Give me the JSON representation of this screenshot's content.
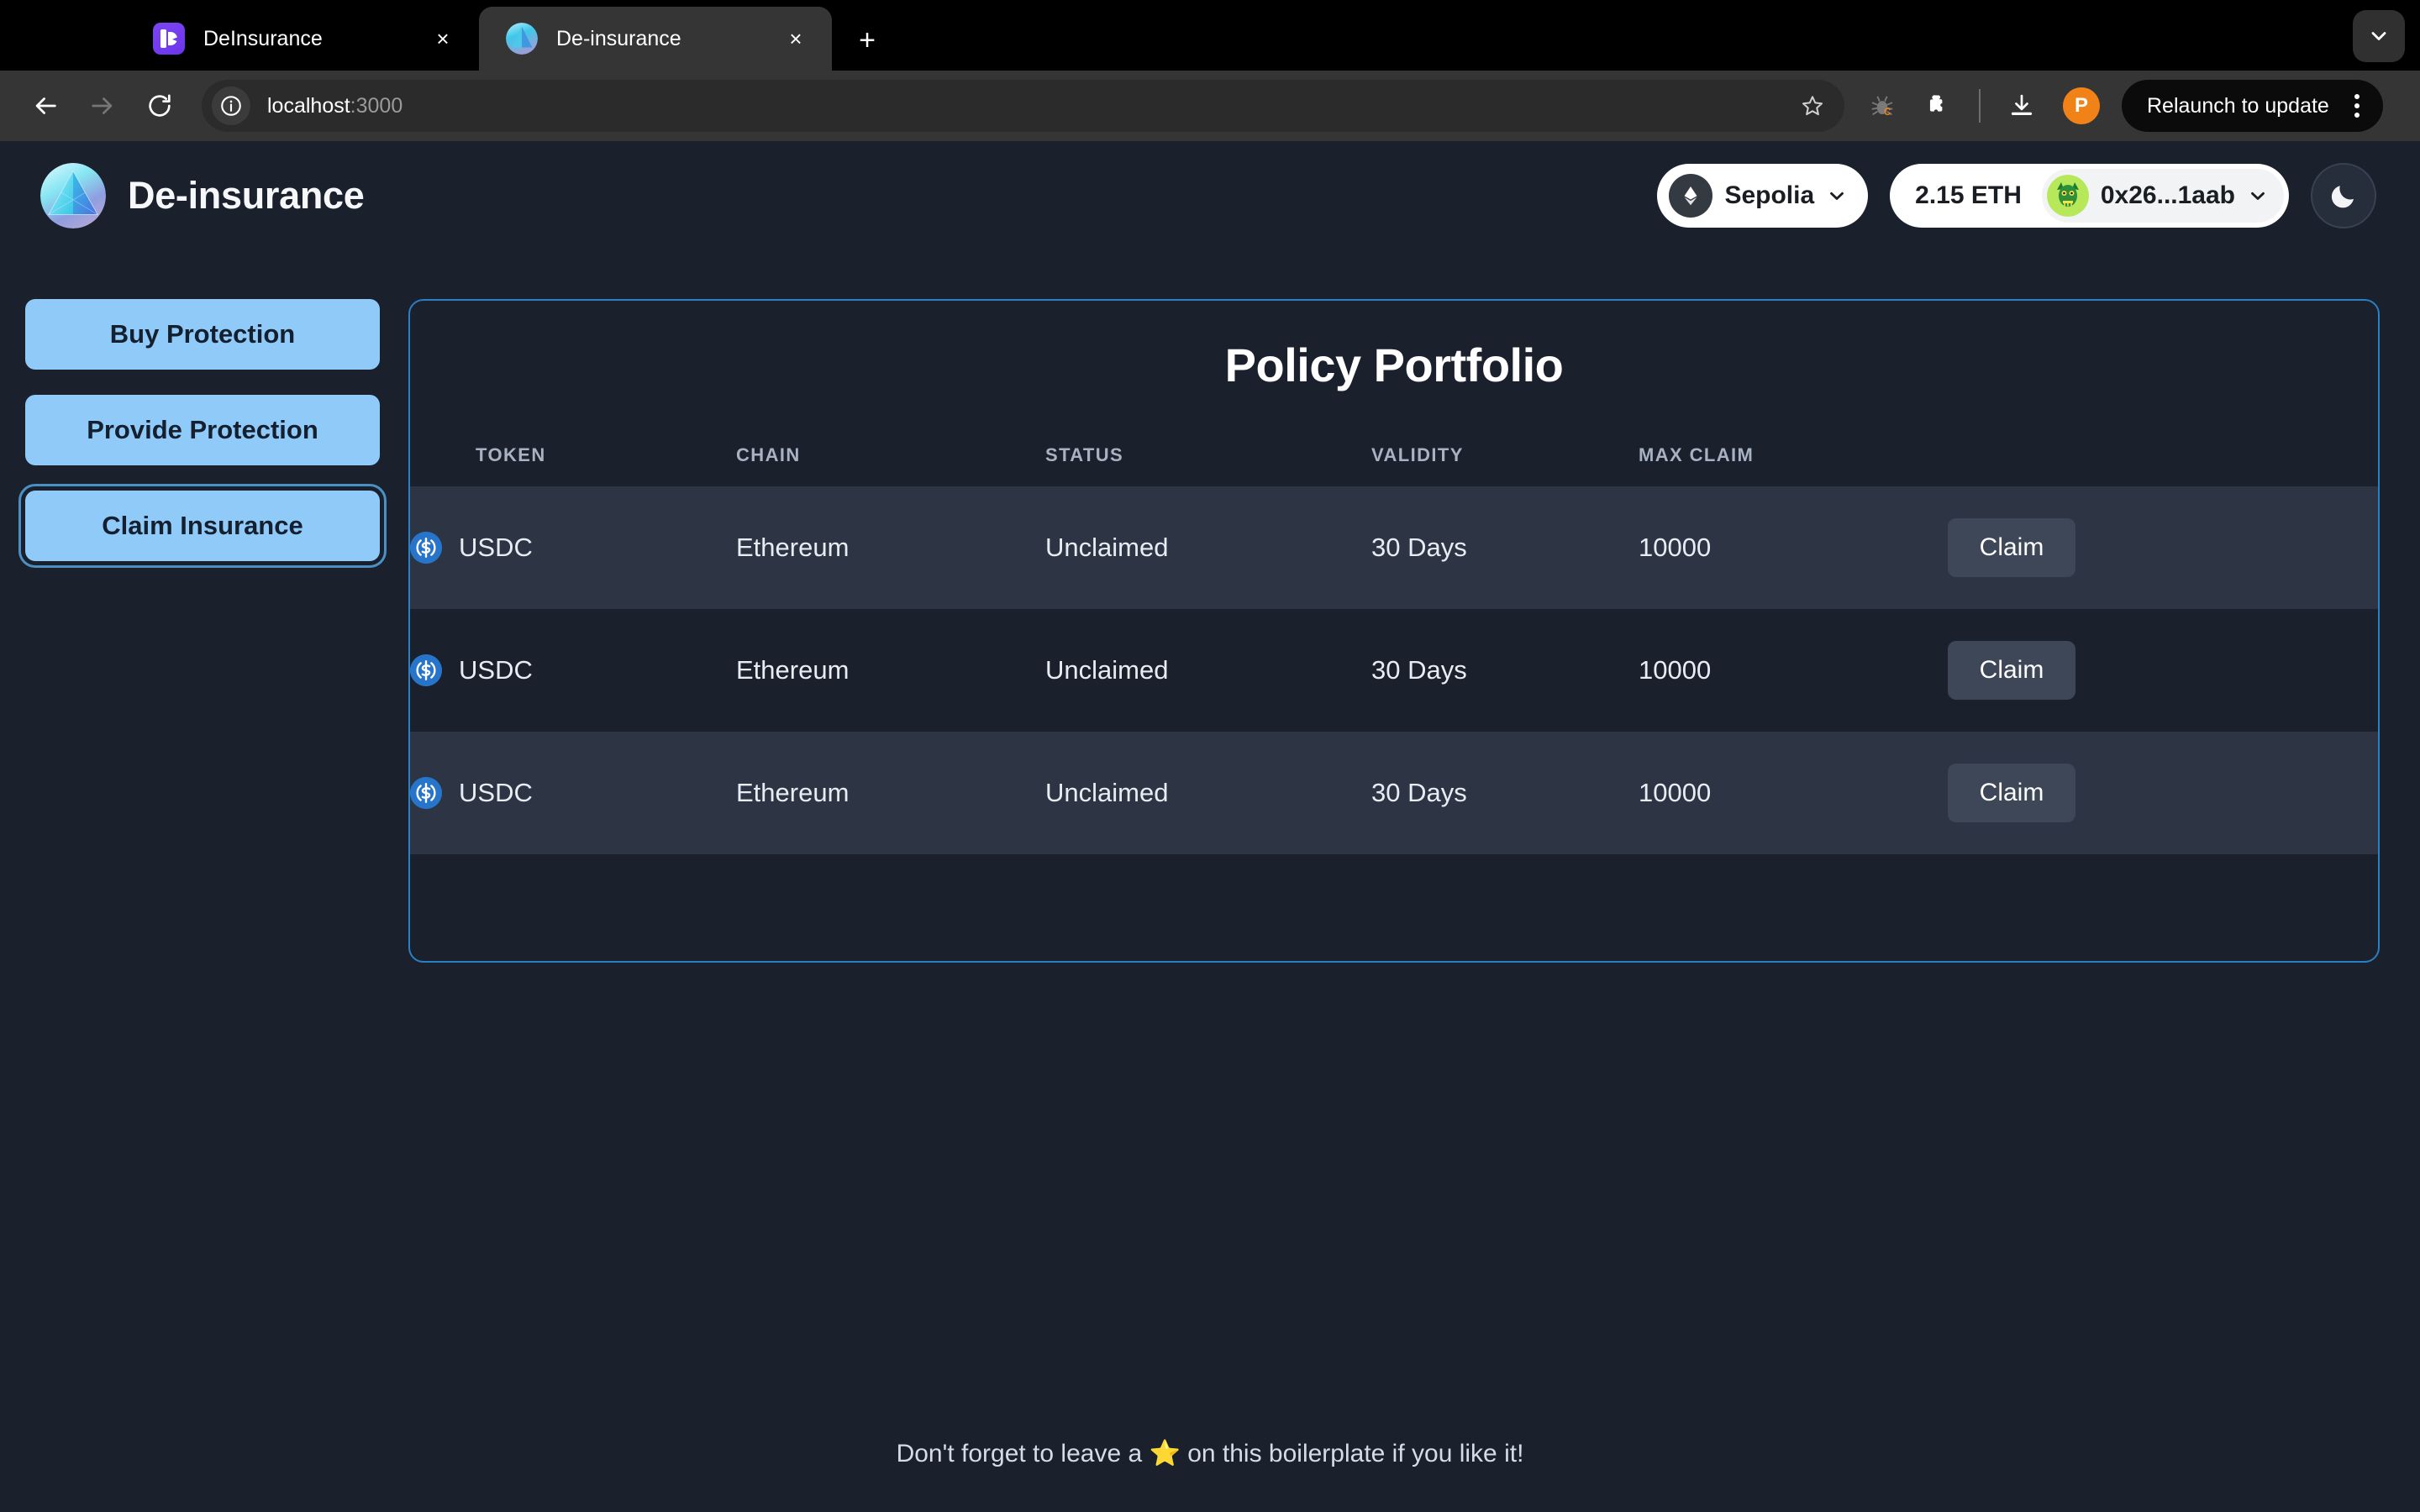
{
  "browser": {
    "tabs": [
      {
        "title": "DeInsurance",
        "favicon": "deinsurance-purple-favicon",
        "active": false
      },
      {
        "title": "De-insurance",
        "favicon": "de-insurance-logo-favicon",
        "active": true
      }
    ],
    "new_tab_label": "+",
    "close_label": "×",
    "toolbar": {
      "back_icon": "back-arrow-icon",
      "forward_icon": "forward-arrow-icon",
      "reload_icon": "reload-icon",
      "site_info_icon": "info-circle-icon",
      "url_host": "localhost",
      "url_port": ":3000",
      "bookmark_icon": "star-icon",
      "bug_icon": "bug-icon",
      "extensions_icon": "extensions-puzzle-icon",
      "downloads_icon": "download-icon",
      "profile_initial": "P",
      "relaunch_label": "Relaunch to update",
      "menu_icon": "kebab-menu-icon"
    },
    "tab_list_icon": "chevron-down-icon"
  },
  "app": {
    "brand": {
      "name": "De-insurance",
      "logo_icon": "de-insurance-pyramid-logo"
    },
    "header": {
      "chain": {
        "label": "Sepolia",
        "icon": "ethereum-diamond-icon",
        "chevron": "chevron-down-icon"
      },
      "account": {
        "balance": "2.15 ETH",
        "address": "0x26...1aab",
        "avatar_icon": "wallet-avatar",
        "chevron": "chevron-down-icon"
      },
      "theme_toggle_icon": "moon-icon"
    },
    "sidebar": {
      "items": [
        {
          "label": "Buy Protection",
          "focused": false
        },
        {
          "label": "Provide Protection",
          "focused": false
        },
        {
          "label": "Claim Insurance",
          "focused": true
        }
      ]
    },
    "main": {
      "title": "Policy Portfolio",
      "table": {
        "columns": [
          "TOKEN",
          "CHAIN",
          "STATUS",
          "VALIDITY",
          "MAX CLAIM",
          ""
        ],
        "rows": [
          {
            "token": "USDC",
            "token_icon": "usdc-icon",
            "chain": "Ethereum",
            "status": "Unclaimed",
            "validity": "30 Days",
            "max_claim": "10000",
            "action": "Claim"
          },
          {
            "token": "USDC",
            "token_icon": "usdc-icon",
            "chain": "Ethereum",
            "status": "Unclaimed",
            "validity": "30 Days",
            "max_claim": "10000",
            "action": "Claim"
          },
          {
            "token": "USDC",
            "token_icon": "usdc-icon",
            "chain": "Ethereum",
            "status": "Unclaimed",
            "validity": "30 Days",
            "max_claim": "10000",
            "action": "Claim"
          }
        ]
      }
    },
    "footer": {
      "text_before": "Don't forget to leave a ",
      "star": "⭐",
      "text_after": " on this boilerplate if you like it!"
    },
    "colors": {
      "page_background": "#1a202c",
      "card_border": "#2b7fc4",
      "sidebar_button": "#90caf9",
      "row_striped": "#2d3545",
      "usdc_blue": "#2775ca",
      "claim_button": "#3e4758",
      "profile_orange": "#f08218"
    }
  }
}
